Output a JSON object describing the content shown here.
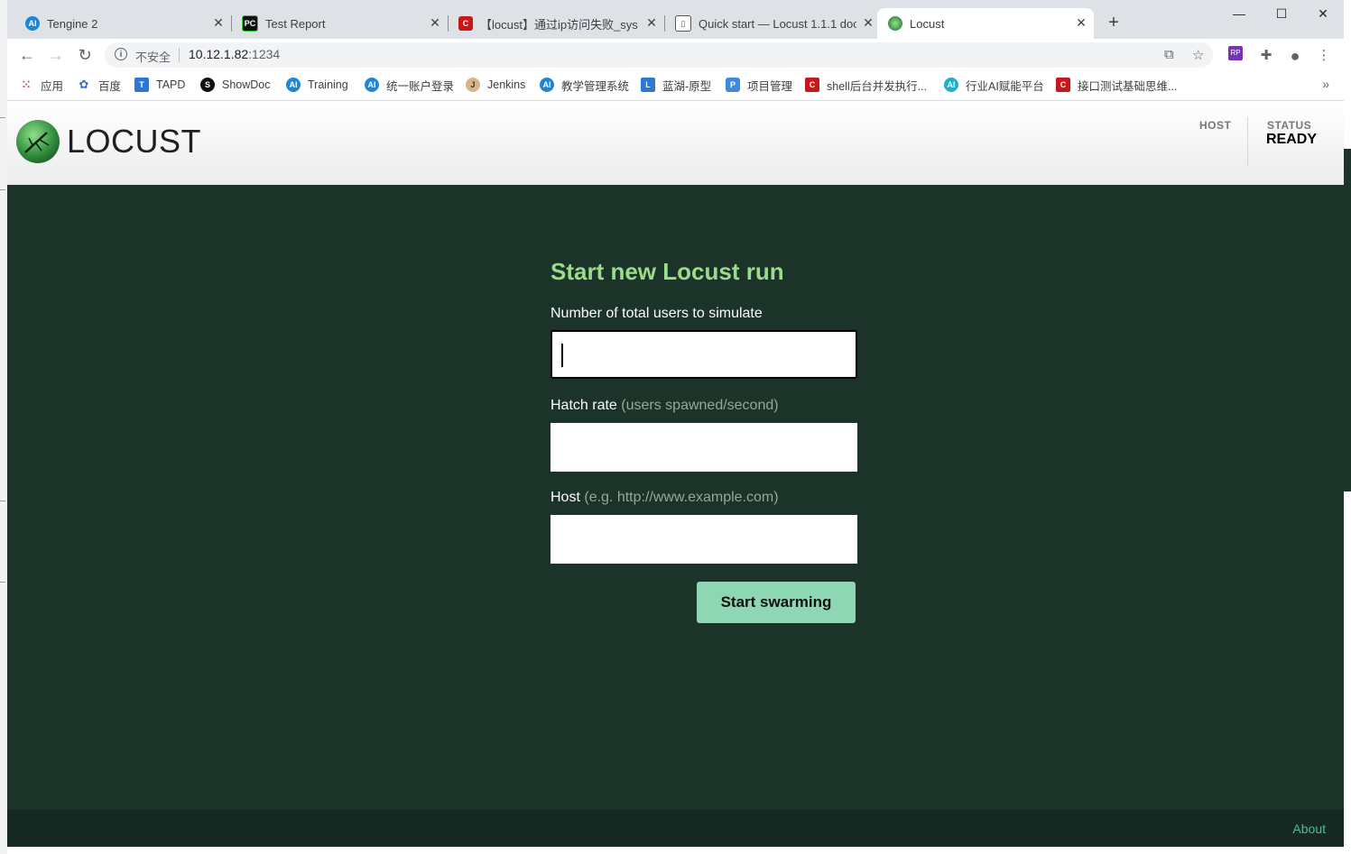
{
  "browser": {
    "tabs": [
      {
        "title": "Tengine 2",
        "icon": "ai-logo-icon"
      },
      {
        "title": "Test Report",
        "icon": "pycharm-icon"
      },
      {
        "title": "【locust】通过ip访问失败_sysu_",
        "icon": "csdn-icon"
      },
      {
        "title": "Quick start — Locust 1.1.1 doc",
        "icon": "docs-book-icon"
      },
      {
        "title": "Locust",
        "icon": "locust-icon",
        "active": true
      }
    ],
    "security_label": "不安全",
    "url_host": "10.12.1.82",
    "url_port": ":1234",
    "bookmarks": [
      {
        "label": "应用",
        "icon": "apps-grid-icon"
      },
      {
        "label": "百度",
        "icon": "baidu-paw-icon"
      },
      {
        "label": "TAPD",
        "icon": "tapd-icon"
      },
      {
        "label": "ShowDoc",
        "icon": "showdoc-icon"
      },
      {
        "label": "Training",
        "icon": "ai-logo-icon"
      },
      {
        "label": "统一账户登录",
        "icon": "ai-logo-icon"
      },
      {
        "label": "Jenkins",
        "icon": "jenkins-icon"
      },
      {
        "label": "教学管理系统",
        "icon": "ai-logo-icon"
      },
      {
        "label": "蓝湖-原型",
        "icon": "lanhu-icon"
      },
      {
        "label": "项目管理",
        "icon": "project-icon"
      },
      {
        "label": "shell后台并发执行...",
        "icon": "csdn-icon"
      },
      {
        "label": "行业AI赋能平台",
        "icon": "ai-logo-icon"
      },
      {
        "label": "接口测试基础思维...",
        "icon": "csdn-icon"
      }
    ],
    "bookmarks_more": "»"
  },
  "header": {
    "logo_text": "LOCUST",
    "host_label": "HOST",
    "status_label": "STATUS",
    "status_value": "READY"
  },
  "form": {
    "title": "Start new Locust run",
    "users_label": "Number of total users to simulate",
    "users_value": "",
    "hatch_label": "Hatch rate",
    "hatch_hint": "(users spawned/second)",
    "hatch_value": "",
    "host_label": "Host",
    "host_hint": "(e.g. http://www.example.com)",
    "host_value": "",
    "submit_label": "Start swarming"
  },
  "footer": {
    "about_label": "About"
  },
  "colors": {
    "page_bg": "#1b3329",
    "title_green": "#9bdb8b",
    "button_bg": "#8dd7b4",
    "about_link": "#4fbf8f"
  }
}
